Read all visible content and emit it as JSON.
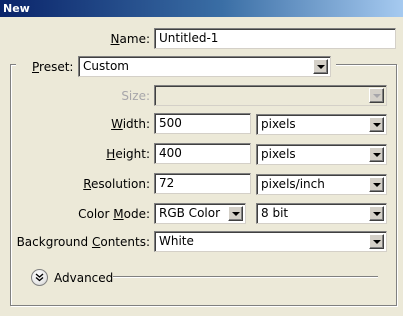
{
  "window": {
    "title": "New"
  },
  "name": {
    "label_u": "N",
    "label_rest": "ame:",
    "value": "Untitled-1"
  },
  "preset": {
    "label_u": "P",
    "label_rest": "reset:",
    "value": "Custom"
  },
  "size": {
    "label": "Size:",
    "value": "",
    "enabled": false
  },
  "width": {
    "label_u": "W",
    "label_rest": "idth:",
    "value": "500",
    "unit": "pixels"
  },
  "height": {
    "label_u": "H",
    "label_rest": "eight:",
    "value": "400",
    "unit": "pixels"
  },
  "resolution": {
    "label_u": "R",
    "label_rest": "esolution:",
    "value": "72",
    "unit": "pixels/inch"
  },
  "color_mode": {
    "label_pre": "Color ",
    "label_u": "M",
    "label_rest": "ode:",
    "value": "RGB Color",
    "depth": "8 bit"
  },
  "background": {
    "label_pre": "Background ",
    "label_u": "C",
    "label_rest": "ontents:",
    "value": "White"
  },
  "advanced": {
    "label": "Advanced"
  },
  "colors": {
    "titlebar": "#0a246a",
    "dialog_bg": "#ece9d8",
    "disabled_text": "#a7a6aa"
  },
  "icons": {
    "arrow": "chevron-down-icon",
    "advanced": "double-chevron-down-icon"
  }
}
